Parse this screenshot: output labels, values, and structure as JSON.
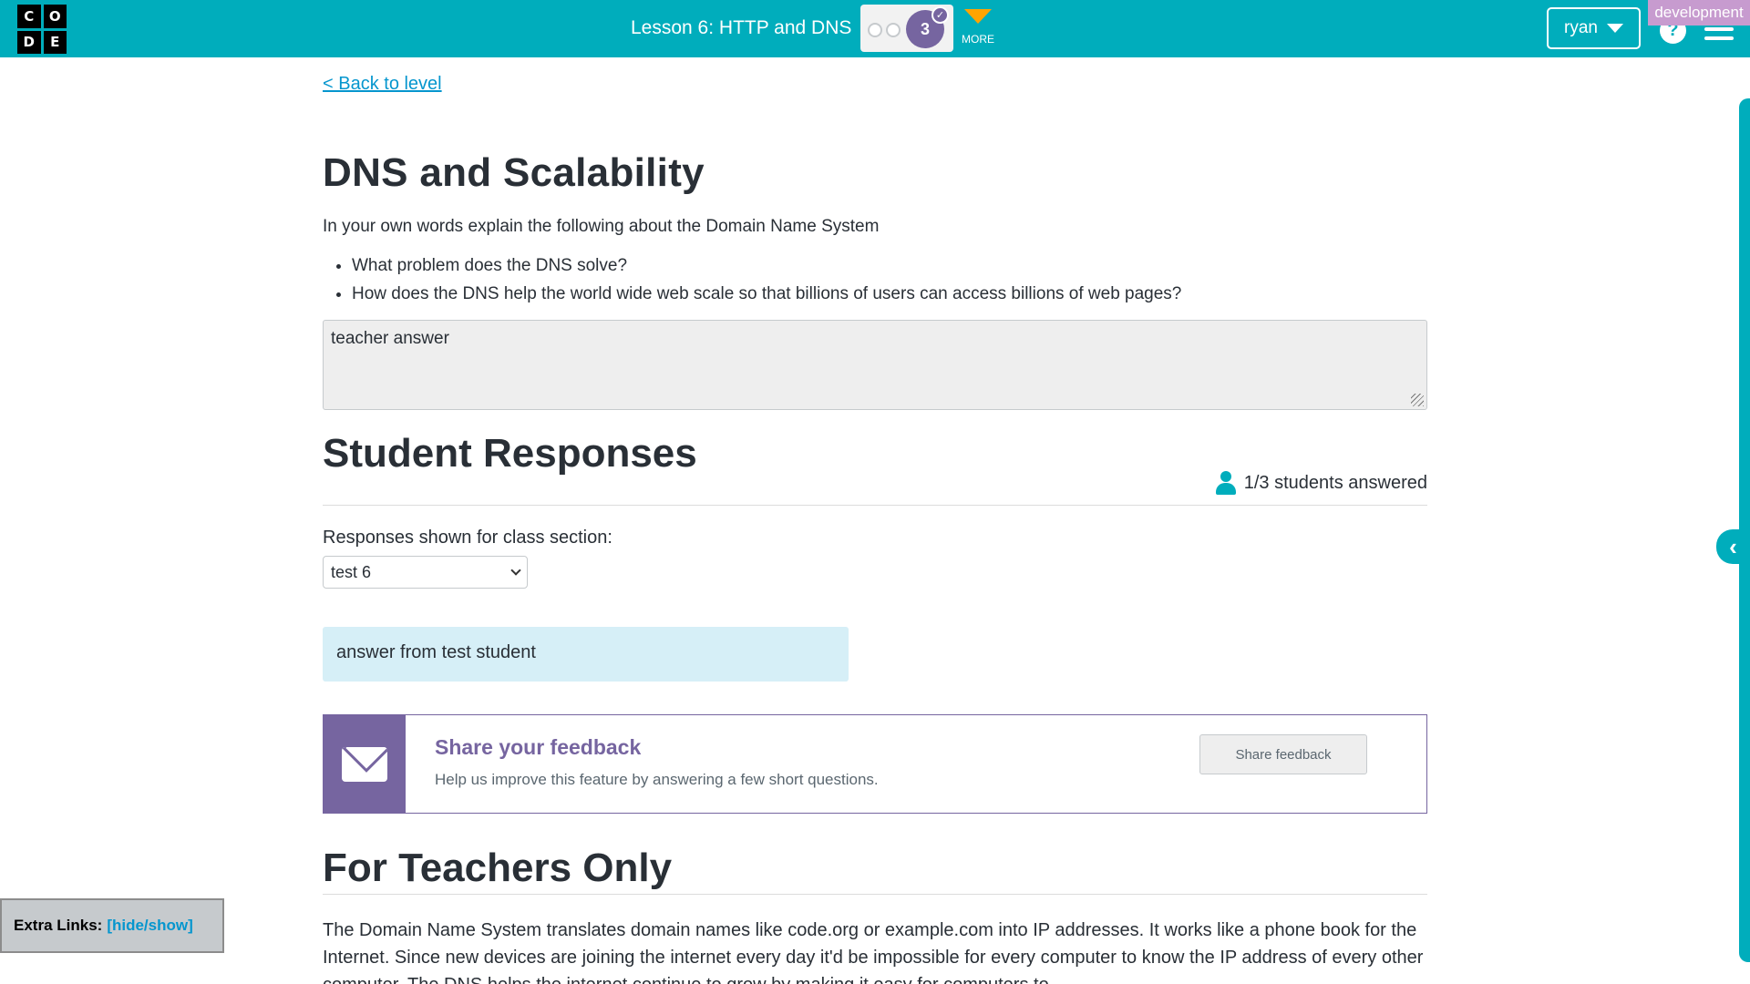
{
  "header": {
    "logo_letters": [
      "C",
      "O",
      "D",
      "E"
    ],
    "lesson_title": "Lesson 6: HTTP and DNS",
    "progress_current": "3",
    "more_label": "MORE",
    "user_name": "ryan",
    "env_tag": "development",
    "help_glyph": "?",
    "icons": {
      "help": "help-icon",
      "menu": "hamburger-menu-icon",
      "check": "check-icon",
      "more": "caret-down-icon"
    }
  },
  "level": {
    "back_link": "< Back to level",
    "title": "DNS and Scalability",
    "intro": "In your own words explain the following about the Domain Name System",
    "bullets": [
      "What problem does the DNS solve?",
      "How does the DNS help the world wide web scale so that billions of users can access billions of web pages?"
    ],
    "answer_text": "teacher answer"
  },
  "responses": {
    "heading": "Student Responses",
    "answered_count": "1/3 students answered",
    "section_label": "Responses shown for class section:",
    "section_selected": "test 6",
    "student_answer": "answer from test student"
  },
  "feedback": {
    "title": "Share your feedback",
    "subtitle": "Help us improve this feature by answering a few short questions.",
    "button": "Share feedback"
  },
  "teachers": {
    "heading": "For Teachers Only",
    "text": "The Domain Name System translates domain names like code.org or example.com into IP addresses. It works like a phone book for the Internet. Since new devices are joining the internet every day it'd be impossible for every computer to know the IP address of every other computer. The DNS helps the internet continue to grow by making it easy for computers to"
  },
  "extra_links": {
    "label": "Extra Links:",
    "link": "[hide/show]"
  },
  "colors": {
    "header_teal": "#00adbc",
    "purple": "#7665a0",
    "link_blue": "#0596ce",
    "dev_pink": "#c79bcf",
    "more_orange": "#ffa400"
  }
}
